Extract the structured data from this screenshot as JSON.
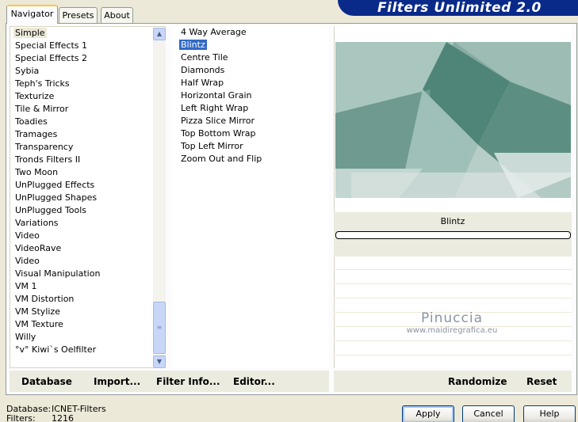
{
  "banner": {
    "title": "Filters Unlimited 2.0"
  },
  "tabs": [
    {
      "label": "Navigator",
      "active": true
    },
    {
      "label": "Presets",
      "active": false
    },
    {
      "label": "About",
      "active": false
    }
  ],
  "categories": {
    "selected": "Simple",
    "items": [
      "Simple",
      "Special Effects 1",
      "Special Effects 2",
      "Sybia",
      "Teph's Tricks",
      "Texturize",
      "Tile & Mirror",
      "Toadies",
      "Tramages",
      "Transparency",
      "Tronds Filters II",
      "Two Moon",
      "UnPlugged Effects",
      "UnPlugged Shapes",
      "UnPlugged Tools",
      "Variations",
      "Video",
      "VideoRave",
      "Video",
      "Visual Manipulation",
      "VM 1",
      "VM Distortion",
      "VM Stylize",
      "VM Texture",
      "Willy",
      "°v° Kiwi`s Oelfilter"
    ]
  },
  "filters": {
    "selected": "Blintz",
    "items": [
      "4 Way Average",
      "Blintz",
      "Centre Tile",
      "Diamonds",
      "Half Wrap",
      "Horizontal Grain",
      "Left Right Wrap",
      "Pizza Slice Mirror",
      "Top Bottom Wrap",
      "Top Left Mirror",
      "Zoom Out and Flip"
    ]
  },
  "preview": {
    "filter_name": "Blintz",
    "watermark": "Pinuccia",
    "watermark_url": "www.maidiregrafica.eu"
  },
  "actions": {
    "database": "Database",
    "import": "Import...",
    "filter_info": "Filter Info...",
    "editor": "Editor...",
    "randomize": "Randomize",
    "reset": "Reset"
  },
  "footer": {
    "database_label": "Database:",
    "database_value": "ICNET-Filters",
    "filters_label": "Filters:",
    "filters_value": "1216",
    "apply": "Apply",
    "cancel": "Cancel",
    "help": "Help"
  },
  "icons": {
    "scroll_up": "scroll-up-icon",
    "scroll_down": "scroll-down-icon",
    "grip": "scroll-grip-icon"
  }
}
